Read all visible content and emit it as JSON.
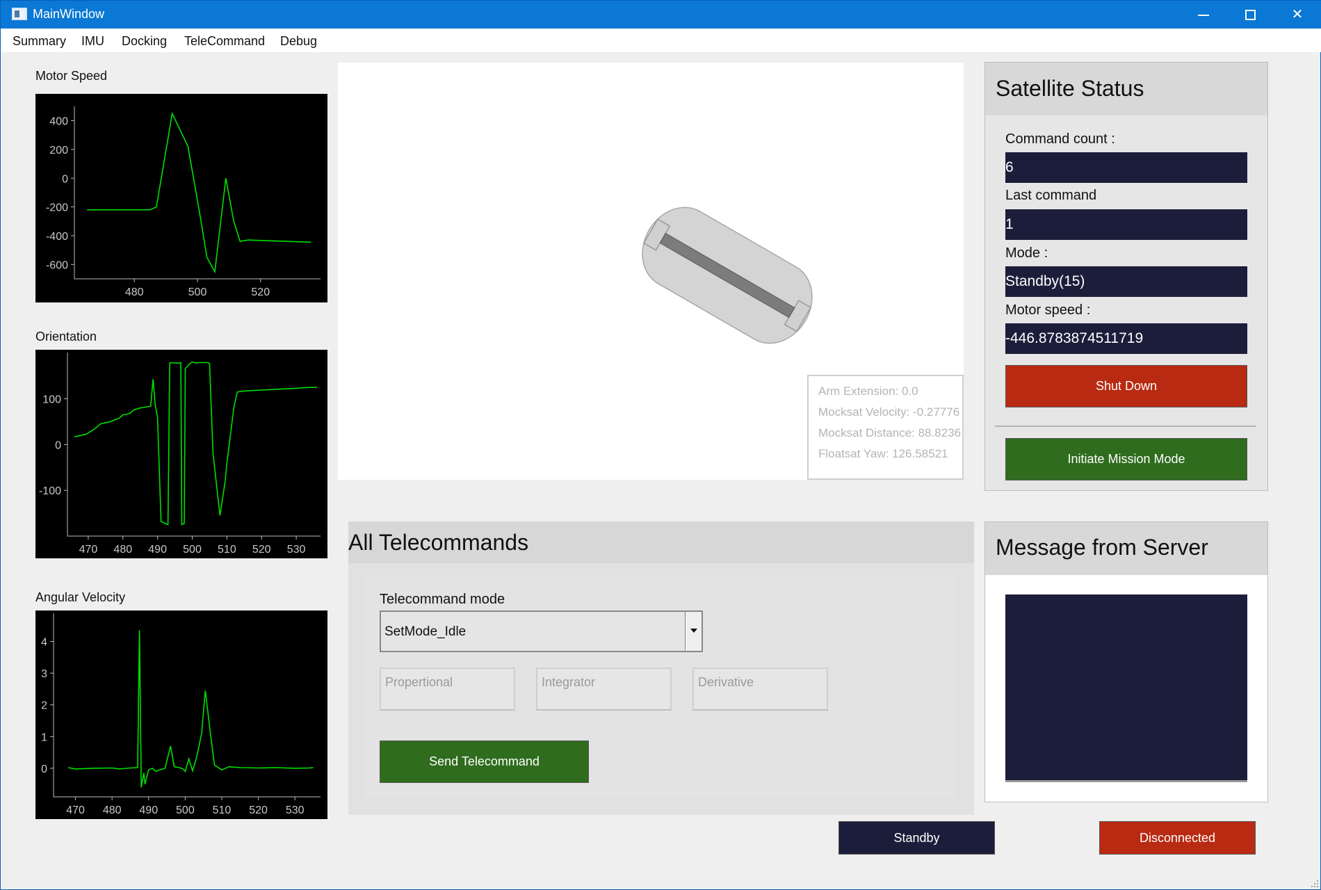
{
  "window": {
    "title": "MainWindow"
  },
  "menu": [
    "Summary",
    "IMU",
    "Docking",
    "TeleCommand",
    "Debug"
  ],
  "plots": [
    {
      "label": "Motor Speed",
      "color": "#00e000",
      "xticks": [
        480,
        500,
        520
      ],
      "yticks": [
        400,
        200,
        0,
        -200,
        -400,
        -600
      ],
      "xlim": [
        461,
        539
      ],
      "ylim": [
        -700,
        480
      ],
      "x": [
        465,
        485,
        487,
        492,
        497,
        501,
        503,
        505.5,
        509,
        511.5,
        513.5,
        516,
        536
      ],
      "y": [
        -220,
        -220,
        -200,
        450,
        220,
        -280,
        -550,
        -650,
        0,
        -300,
        -440,
        -430,
        -445
      ]
    },
    {
      "label": "Orientation",
      "color": "#00e000",
      "xticks": [
        470,
        480,
        490,
        500,
        510,
        520,
        530
      ],
      "yticks": [
        100,
        0,
        -100
      ],
      "xlim": [
        464,
        537
      ],
      "ylim": [
        -200,
        195
      ],
      "x": [
        466,
        468,
        469.5,
        471,
        472,
        473.5,
        475,
        476,
        478,
        479,
        480,
        481,
        482,
        483,
        485,
        486,
        488,
        488.7,
        489.3,
        490,
        491,
        492,
        493,
        493.5,
        494,
        495.5,
        496.2,
        496.7,
        497,
        497.7,
        498,
        498.5,
        499,
        499.5,
        500,
        500.5,
        501,
        502,
        503,
        504.5,
        505,
        506,
        508,
        509.5,
        510,
        511,
        512,
        513,
        515,
        520,
        525,
        530,
        534,
        536
      ],
      "y": [
        17,
        20,
        23,
        30,
        35,
        45,
        48,
        49,
        55,
        58,
        65,
        66,
        68,
        75,
        80,
        81,
        84,
        143,
        87,
        60,
        -168,
        -172,
        -175,
        178,
        179,
        178,
        178,
        179,
        -175,
        -172,
        166,
        170,
        174,
        178,
        180,
        180,
        178,
        179,
        179,
        179,
        177,
        -20,
        -155,
        -80,
        -40,
        20,
        80,
        115,
        117,
        119,
        121,
        123,
        125,
        125
      ]
    },
    {
      "label": "Angular Velocity",
      "color": "#00e000",
      "xticks": [
        470,
        480,
        490,
        500,
        510,
        520,
        530
      ],
      "yticks": [
        4,
        3,
        2,
        1,
        0
      ],
      "xlim": [
        464,
        537
      ],
      "ylim": [
        -0.9,
        4.8
      ],
      "x": [
        468,
        470,
        475,
        480,
        482,
        485,
        487,
        487.5,
        488,
        488.7,
        489,
        490,
        491,
        492,
        493,
        494.5,
        496,
        497,
        498,
        499,
        499.5,
        500,
        501,
        502,
        503,
        503.5,
        504.5,
        505.5,
        507,
        508,
        510,
        512,
        515,
        520,
        525,
        530,
        534,
        535
      ],
      "y": [
        0.02,
        -0.02,
        0.0,
        0.01,
        -0.02,
        0.01,
        0.02,
        4.35,
        -0.6,
        -0.15,
        -0.5,
        -0.05,
        0.0,
        -0.1,
        -0.05,
        0.0,
        0.7,
        0.05,
        0.03,
        0.0,
        -0.03,
        -0.1,
        0.3,
        -0.08,
        0.3,
        0.55,
        1.1,
        2.45,
        1.0,
        0.1,
        -0.05,
        0.05,
        0.02,
        0.01,
        0.02,
        0.0,
        0.01,
        0.02
      ]
    }
  ],
  "scene": {
    "body_color": "#d4d4d4",
    "arm_color": "#7c7c7c",
    "overlay": [
      "Arm Extension: 0.0",
      "Mocksat Velocity: -0.27776",
      "Mocksat Distance: 88.8236",
      "Floatsat Yaw: 126.58521"
    ]
  },
  "status": {
    "title": "Satellite Status",
    "fields": [
      {
        "label": "Command count :",
        "value": "6"
      },
      {
        "label": "Last command",
        "value": "1"
      },
      {
        "label": "Mode :",
        "value": "Standby(15)"
      },
      {
        "label": "Motor speed :",
        "value": "-446.8783874511719"
      }
    ],
    "shutdown_label": "Shut Down",
    "mission_label": "Initiate Mission Mode"
  },
  "telecommands": {
    "title": "All Telecommands",
    "mode_label": "Telecommand mode",
    "mode_value": "SetMode_Idle",
    "placeholders": [
      "Propertional",
      "Integrator",
      "Derivative"
    ],
    "send_label": "Send Telecommand"
  },
  "messages": {
    "title": "Message from Server"
  },
  "footer": {
    "mode_label": "Standby",
    "connection_label": "Disconnected"
  },
  "colors": {
    "titlebar": "#0a78d4",
    "navy": "#1b1d3a",
    "red": "#b92a12",
    "green": "#2f6c1e",
    "plot_line": "#00e000"
  }
}
